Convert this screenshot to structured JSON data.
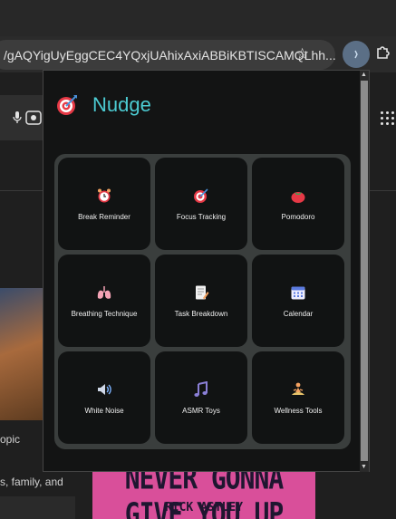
{
  "browser": {
    "url": "/gAQYigUyEggCEC4YQxjUAhixAxiABBiKBTISCAMQLhh...",
    "icons": [
      "star-icon",
      "extension-icon",
      "puzzle-icon"
    ]
  },
  "background_page": {
    "snippet_1": "opic",
    "snippet_2": "s, family, and",
    "thumbnail_title": "NEVER GONNA GIVE YOU UP",
    "thumbnail_artist": "RICK ASTLEY"
  },
  "popup": {
    "title": "Nudge",
    "logo_icon": "target-dart-icon",
    "features": [
      {
        "label": "Break Reminder",
        "icon": "alarm-clock-icon"
      },
      {
        "label": "Focus Tracking",
        "icon": "target-dart-icon"
      },
      {
        "label": "Pomodoro",
        "icon": "tomato-icon"
      },
      {
        "label": "Breathing Technique",
        "icon": "lungs-icon"
      },
      {
        "label": "Task Breakdown",
        "icon": "memo-icon"
      },
      {
        "label": "Calendar",
        "icon": "calendar-icon"
      },
      {
        "label": "White Noise",
        "icon": "speaker-icon"
      },
      {
        "label": "ASMR Toys",
        "icon": "music-notes-icon"
      },
      {
        "label": "Wellness Tools",
        "icon": "meditation-icon"
      }
    ]
  }
}
